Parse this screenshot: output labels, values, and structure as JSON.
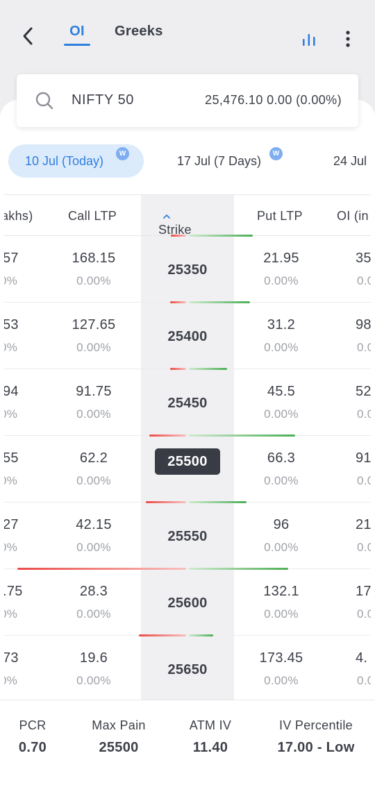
{
  "header": {
    "tabs": [
      {
        "label": "OI",
        "active": true
      },
      {
        "label": "Greeks",
        "active": false
      }
    ],
    "accent_color": "#2f7fe0"
  },
  "search": {
    "symbol": "NIFTY 50",
    "quote": "25,476.10 0.00 (0.00%)"
  },
  "expiries": [
    {
      "label": "10 Jul (Today)",
      "badge": "W",
      "active": true
    },
    {
      "label": "17 Jul (7 Days)",
      "badge": "W",
      "active": false
    },
    {
      "label": "24 Jul",
      "active": false
    }
  ],
  "table": {
    "columns": {
      "oi_left": "akhs)",
      "call_ltp": "Call LTP",
      "strike": "Strike",
      "put_ltp": "Put LTP",
      "oi_right": "OI (in"
    },
    "rows": [
      {
        "oi_left": "57",
        "oi_left_chg": "0%",
        "call_ltp": "168.15",
        "call_chg": "0.00%",
        "strike": "25350",
        "put_ltp": "21.95",
        "put_chg": "0.00%",
        "oi_right": "35",
        "oi_right_chg": "0.0"
      },
      {
        "oi_left": "53",
        "oi_left_chg": "0%",
        "call_ltp": "127.65",
        "call_chg": "0.00%",
        "strike": "25400",
        "put_ltp": "31.2",
        "put_chg": "0.00%",
        "oi_right": "98",
        "oi_right_chg": "0.0"
      },
      {
        "oi_left": "94",
        "oi_left_chg": "0%",
        "call_ltp": "91.75",
        "call_chg": "0.00%",
        "strike": "25450",
        "put_ltp": "45.5",
        "put_chg": "0.00%",
        "oi_right": "52",
        "oi_right_chg": "0.0"
      },
      {
        "oi_left": "55",
        "oi_left_chg": "0%",
        "call_ltp": "62.2",
        "call_chg": "0.00%",
        "strike": "25500",
        "put_ltp": "66.3",
        "put_chg": "0.00%",
        "oi_right": "91",
        "oi_right_chg": "0.0",
        "atm": true
      },
      {
        "oi_left": "27",
        "oi_left_chg": "0%",
        "call_ltp": "42.15",
        "call_chg": "0.00%",
        "strike": "25550",
        "put_ltp": "96",
        "put_chg": "0.00%",
        "oi_right": "21",
        "oi_right_chg": "0.0"
      },
      {
        "oi_left": ".75",
        "oi_left_chg": "0%",
        "call_ltp": "28.3",
        "call_chg": "0.00%",
        "strike": "25600",
        "put_ltp": "132.1",
        "put_chg": "0.00%",
        "oi_right": "17",
        "oi_right_chg": "0.0"
      },
      {
        "oi_left": "73",
        "oi_left_chg": "0%",
        "call_ltp": "19.6",
        "call_chg": "0.00%",
        "strike": "25650",
        "put_ltp": "173.45",
        "put_chg": "0.00%",
        "oi_right": "4.",
        "oi_right_chg": "0.0"
      }
    ],
    "oi_bars": [
      {
        "call_oi_rel": 0.09,
        "put_oi_rel": 0.35
      },
      {
        "call_oi_rel": 0.09,
        "put_oi_rel": 0.22
      },
      {
        "call_oi_rel": 0.21,
        "put_oi_rel": 0.61
      },
      {
        "call_oi_rel": 0.23,
        "put_oi_rel": 0.33
      },
      {
        "call_oi_rel": 0.97,
        "put_oi_rel": 0.57
      },
      {
        "call_oi_rel": 0.27,
        "put_oi_rel": 0.14
      },
      {
        "call_oi_rel": 0.53,
        "put_oi_rel": 0.11
      }
    ],
    "call_bar_color": "#ec4a45",
    "put_bar_color": "#4cae55"
  },
  "footer": {
    "stats": [
      {
        "label": "PCR",
        "value": "0.70"
      },
      {
        "label": "Max Pain",
        "value": "25500"
      },
      {
        "label": "ATM IV",
        "value": "11.40"
      },
      {
        "label": "IV Percentile",
        "value": "17.00 - Low"
      }
    ]
  }
}
